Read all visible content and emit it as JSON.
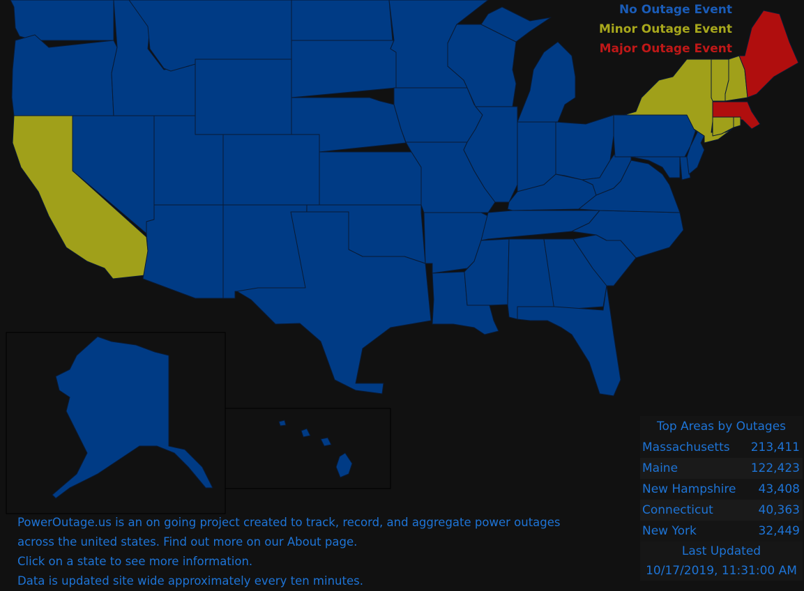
{
  "colors": {
    "background": "#111111",
    "no_outage": "#003b85",
    "minor_outage": "#a0a01a",
    "major_outage": "#b00e0e",
    "text_blue": "#1e74d6"
  },
  "legend": {
    "no_outage": "No Outage Event",
    "minor_outage": "Minor Outage Event",
    "major_outage": "Major Outage Event"
  },
  "states": {
    "Washington": "none",
    "Oregon": "none",
    "California": "minor",
    "Nevada": "none",
    "Idaho": "none",
    "Montana": "none",
    "Wyoming": "none",
    "Utah": "none",
    "Arizona": "none",
    "Colorado": "none",
    "New Mexico": "none",
    "North Dakota": "none",
    "South Dakota": "none",
    "Nebraska": "none",
    "Kansas": "none",
    "Oklahoma": "none",
    "Texas": "none",
    "Minnesota": "none",
    "Iowa": "none",
    "Missouri": "none",
    "Arkansas": "none",
    "Louisiana": "none",
    "Wisconsin": "none",
    "Illinois": "none",
    "Michigan": "none",
    "Indiana": "none",
    "Ohio": "none",
    "Kentucky": "none",
    "Tennessee": "none",
    "Mississippi": "none",
    "Alabama": "none",
    "Georgia": "none",
    "Florida": "none",
    "South Carolina": "none",
    "North Carolina": "none",
    "Virginia": "none",
    "West Virginia": "none",
    "Maryland": "none",
    "Delaware": "none",
    "Pennsylvania": "none",
    "New Jersey": "none",
    "New York": "minor",
    "Connecticut": "minor",
    "Rhode Island": "minor",
    "Massachusetts": "major",
    "Vermont": "minor",
    "New Hampshire": "minor",
    "Maine": "major",
    "Alaska": "none",
    "Hawaii": "none"
  },
  "top_areas": {
    "title": "Top Areas by Outages",
    "rows": [
      {
        "name": "Massachusetts",
        "count": "213,411"
      },
      {
        "name": "Maine",
        "count": "122,423"
      },
      {
        "name": "New Hampshire",
        "count": "43,408"
      },
      {
        "name": "Connecticut",
        "count": "40,363"
      },
      {
        "name": "New York",
        "count": "32,449"
      }
    ],
    "last_updated_label": "Last Updated",
    "last_updated_value": "10/17/2019, 11:31:00 AM"
  },
  "info": {
    "line1": "PowerOutage.us is an on going project created to track, record, and aggregate power outages",
    "line2": "across the united states. Find out more on our About page.",
    "line3": "Click on a state to see more information.",
    "line4": "Data is updated site wide approximately every ten minutes."
  }
}
